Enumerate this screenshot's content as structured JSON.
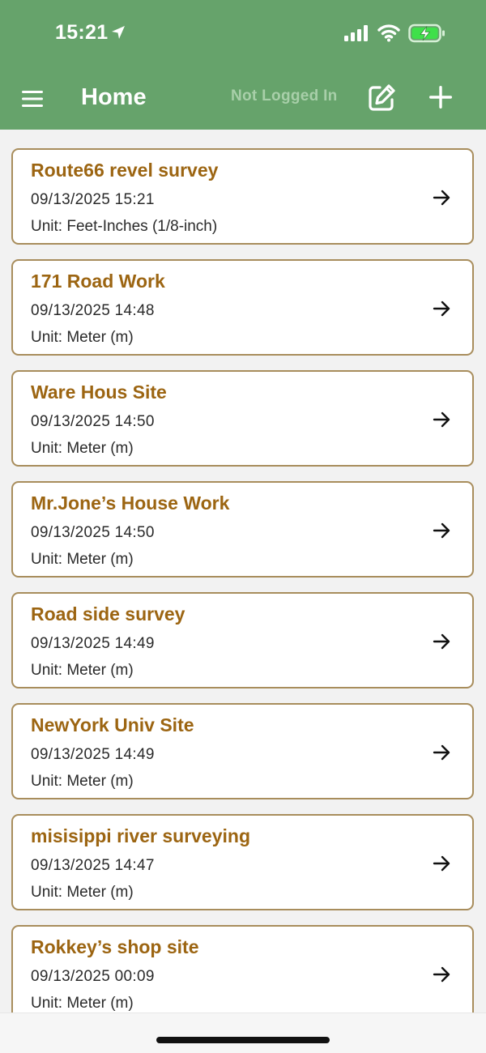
{
  "status_bar": {
    "time": "15:21"
  },
  "app_bar": {
    "title": "Home",
    "login_status": "Not Logged In"
  },
  "icons": {
    "menu": "hamburger-menu-icon",
    "edit": "edit-pencil-square-icon",
    "add": "plus-icon",
    "open": "arrow-right-icon"
  },
  "colors": {
    "header_bg": "#66a36b",
    "card_title": "#9c6512",
    "card_border": "#a88d5c",
    "login_status": "#a8cfa9",
    "battery_charging": "#3fe04a"
  },
  "projects": [
    {
      "title": "Route66 revel survey",
      "date": "09/13/2025 15:21",
      "unit": "Unit: Feet-Inches (1/8-inch)"
    },
    {
      "title": "171 Road Work",
      "date": "09/13/2025 14:48",
      "unit": "Unit: Meter (m)"
    },
    {
      "title": "Ware Hous Site",
      "date": "09/13/2025 14:50",
      "unit": "Unit: Meter (m)"
    },
    {
      "title": "Mr.Jone’s House Work",
      "date": "09/13/2025 14:50",
      "unit": "Unit: Meter (m)"
    },
    {
      "title": "Road side survey",
      "date": "09/13/2025 14:49",
      "unit": "Unit: Meter (m)"
    },
    {
      "title": "NewYork Univ Site",
      "date": "09/13/2025 14:49",
      "unit": "Unit: Meter (m)"
    },
    {
      "title": "misisippi river surveying",
      "date": "09/13/2025 14:47",
      "unit": "Unit: Meter (m)"
    },
    {
      "title": "Rokkey’s shop site",
      "date": "09/13/2025 00:09",
      "unit": "Unit: Meter (m)"
    }
  ]
}
